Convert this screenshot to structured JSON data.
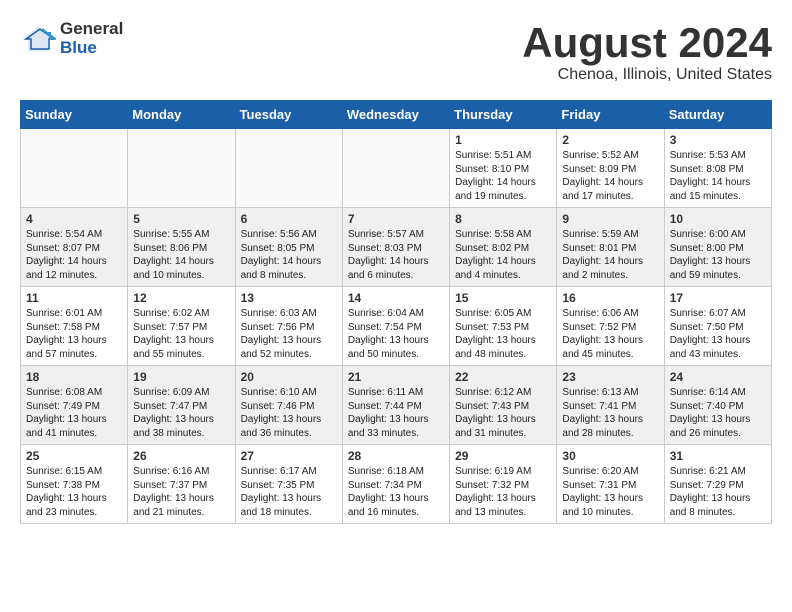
{
  "header": {
    "logo_line1": "General",
    "logo_line2": "Blue",
    "main_title": "August 2024",
    "subtitle": "Chenoa, Illinois, United States"
  },
  "calendar": {
    "days_of_week": [
      "Sunday",
      "Monday",
      "Tuesday",
      "Wednesday",
      "Thursday",
      "Friday",
      "Saturday"
    ],
    "weeks": [
      {
        "row_class": "",
        "days": [
          {
            "num": "",
            "info": "",
            "empty": true
          },
          {
            "num": "",
            "info": "",
            "empty": true
          },
          {
            "num": "",
            "info": "",
            "empty": true
          },
          {
            "num": "",
            "info": "",
            "empty": true
          },
          {
            "num": "1",
            "info": "Sunrise: 5:51 AM\nSunset: 8:10 PM\nDaylight: 14 hours\nand 19 minutes.",
            "empty": false
          },
          {
            "num": "2",
            "info": "Sunrise: 5:52 AM\nSunset: 8:09 PM\nDaylight: 14 hours\nand 17 minutes.",
            "empty": false
          },
          {
            "num": "3",
            "info": "Sunrise: 5:53 AM\nSunset: 8:08 PM\nDaylight: 14 hours\nand 15 minutes.",
            "empty": false
          }
        ]
      },
      {
        "row_class": "alt-row",
        "days": [
          {
            "num": "4",
            "info": "Sunrise: 5:54 AM\nSunset: 8:07 PM\nDaylight: 14 hours\nand 12 minutes.",
            "empty": false
          },
          {
            "num": "5",
            "info": "Sunrise: 5:55 AM\nSunset: 8:06 PM\nDaylight: 14 hours\nand 10 minutes.",
            "empty": false
          },
          {
            "num": "6",
            "info": "Sunrise: 5:56 AM\nSunset: 8:05 PM\nDaylight: 14 hours\nand 8 minutes.",
            "empty": false
          },
          {
            "num": "7",
            "info": "Sunrise: 5:57 AM\nSunset: 8:03 PM\nDaylight: 14 hours\nand 6 minutes.",
            "empty": false
          },
          {
            "num": "8",
            "info": "Sunrise: 5:58 AM\nSunset: 8:02 PM\nDaylight: 14 hours\nand 4 minutes.",
            "empty": false
          },
          {
            "num": "9",
            "info": "Sunrise: 5:59 AM\nSunset: 8:01 PM\nDaylight: 14 hours\nand 2 minutes.",
            "empty": false
          },
          {
            "num": "10",
            "info": "Sunrise: 6:00 AM\nSunset: 8:00 PM\nDaylight: 13 hours\nand 59 minutes.",
            "empty": false
          }
        ]
      },
      {
        "row_class": "",
        "days": [
          {
            "num": "11",
            "info": "Sunrise: 6:01 AM\nSunset: 7:58 PM\nDaylight: 13 hours\nand 57 minutes.",
            "empty": false
          },
          {
            "num": "12",
            "info": "Sunrise: 6:02 AM\nSunset: 7:57 PM\nDaylight: 13 hours\nand 55 minutes.",
            "empty": false
          },
          {
            "num": "13",
            "info": "Sunrise: 6:03 AM\nSunset: 7:56 PM\nDaylight: 13 hours\nand 52 minutes.",
            "empty": false
          },
          {
            "num": "14",
            "info": "Sunrise: 6:04 AM\nSunset: 7:54 PM\nDaylight: 13 hours\nand 50 minutes.",
            "empty": false
          },
          {
            "num": "15",
            "info": "Sunrise: 6:05 AM\nSunset: 7:53 PM\nDaylight: 13 hours\nand 48 minutes.",
            "empty": false
          },
          {
            "num": "16",
            "info": "Sunrise: 6:06 AM\nSunset: 7:52 PM\nDaylight: 13 hours\nand 45 minutes.",
            "empty": false
          },
          {
            "num": "17",
            "info": "Sunrise: 6:07 AM\nSunset: 7:50 PM\nDaylight: 13 hours\nand 43 minutes.",
            "empty": false
          }
        ]
      },
      {
        "row_class": "alt-row",
        "days": [
          {
            "num": "18",
            "info": "Sunrise: 6:08 AM\nSunset: 7:49 PM\nDaylight: 13 hours\nand 41 minutes.",
            "empty": false
          },
          {
            "num": "19",
            "info": "Sunrise: 6:09 AM\nSunset: 7:47 PM\nDaylight: 13 hours\nand 38 minutes.",
            "empty": false
          },
          {
            "num": "20",
            "info": "Sunrise: 6:10 AM\nSunset: 7:46 PM\nDaylight: 13 hours\nand 36 minutes.",
            "empty": false
          },
          {
            "num": "21",
            "info": "Sunrise: 6:11 AM\nSunset: 7:44 PM\nDaylight: 13 hours\nand 33 minutes.",
            "empty": false
          },
          {
            "num": "22",
            "info": "Sunrise: 6:12 AM\nSunset: 7:43 PM\nDaylight: 13 hours\nand 31 minutes.",
            "empty": false
          },
          {
            "num": "23",
            "info": "Sunrise: 6:13 AM\nSunset: 7:41 PM\nDaylight: 13 hours\nand 28 minutes.",
            "empty": false
          },
          {
            "num": "24",
            "info": "Sunrise: 6:14 AM\nSunset: 7:40 PM\nDaylight: 13 hours\nand 26 minutes.",
            "empty": false
          }
        ]
      },
      {
        "row_class": "",
        "days": [
          {
            "num": "25",
            "info": "Sunrise: 6:15 AM\nSunset: 7:38 PM\nDaylight: 13 hours\nand 23 minutes.",
            "empty": false
          },
          {
            "num": "26",
            "info": "Sunrise: 6:16 AM\nSunset: 7:37 PM\nDaylight: 13 hours\nand 21 minutes.",
            "empty": false
          },
          {
            "num": "27",
            "info": "Sunrise: 6:17 AM\nSunset: 7:35 PM\nDaylight: 13 hours\nand 18 minutes.",
            "empty": false
          },
          {
            "num": "28",
            "info": "Sunrise: 6:18 AM\nSunset: 7:34 PM\nDaylight: 13 hours\nand 16 minutes.",
            "empty": false
          },
          {
            "num": "29",
            "info": "Sunrise: 6:19 AM\nSunset: 7:32 PM\nDaylight: 13 hours\nand 13 minutes.",
            "empty": false
          },
          {
            "num": "30",
            "info": "Sunrise: 6:20 AM\nSunset: 7:31 PM\nDaylight: 13 hours\nand 10 minutes.",
            "empty": false
          },
          {
            "num": "31",
            "info": "Sunrise: 6:21 AM\nSunset: 7:29 PM\nDaylight: 13 hours\nand 8 minutes.",
            "empty": false
          }
        ]
      }
    ]
  }
}
